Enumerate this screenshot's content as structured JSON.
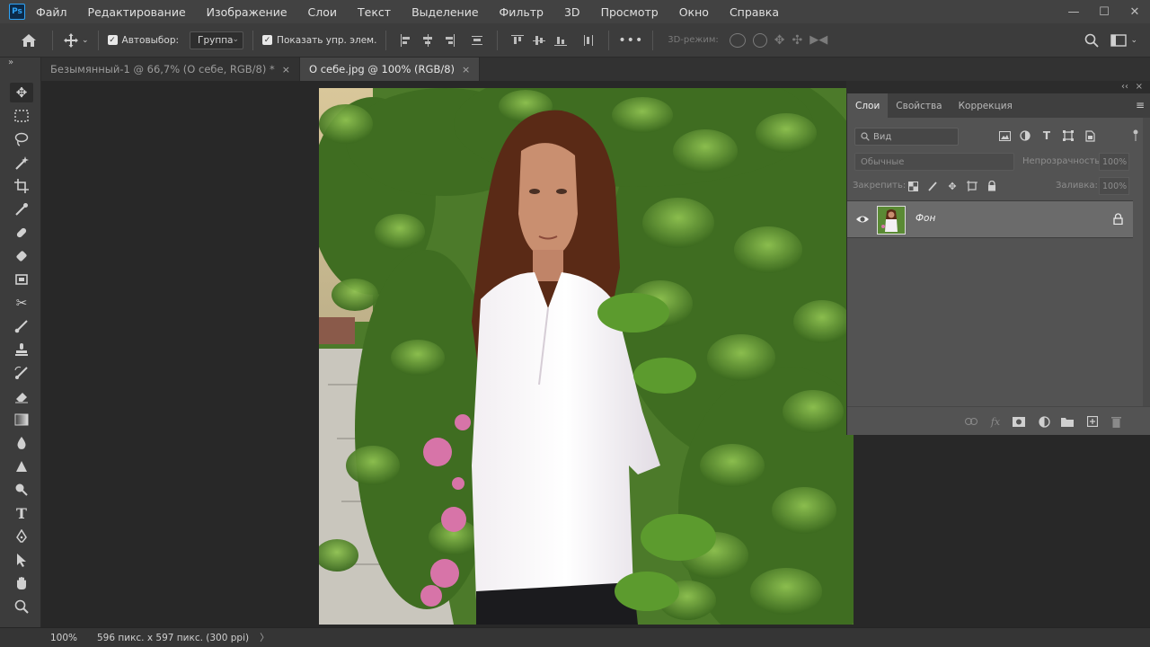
{
  "app": {
    "logo": "Ps"
  },
  "menu": [
    "Файл",
    "Редактирование",
    "Изображение",
    "Слои",
    "Текст",
    "Выделение",
    "Фильтр",
    "3D",
    "Просмотр",
    "Окно",
    "Справка"
  ],
  "window_controls": {
    "minimize": "—",
    "maximize": "☐",
    "close": "✕"
  },
  "options": {
    "autoselect_label": "Автовыбор:",
    "autoselect_checked": true,
    "group_value": "Группа",
    "show_transform_label": "Показать упр. элем.",
    "show_transform_checked": true,
    "mode3d_label": "3D-режим:"
  },
  "toolbar": {
    "collapse": "»",
    "tools": [
      "move-tool",
      "marquee-tool",
      "lasso-tool",
      "magic-wand-tool",
      "crop-tool",
      "eyedropper-tool",
      "healing-brush-tool",
      "patch-tool",
      "frame-tool",
      "content-aware-move-tool",
      "brush-tool",
      "clone-stamp-tool",
      "history-brush-tool",
      "eraser-tool",
      "gradient-tool",
      "blur-tool",
      "sharpen-tool",
      "dodge-tool",
      "type-tool",
      "pen-tool",
      "path-selection-tool",
      "hand-tool",
      "zoom-tool",
      "more-tools"
    ],
    "active_tool": "move-tool"
  },
  "tabs": [
    {
      "label": "Безымянный-1 @ 66,7% (О себе, RGB/8) *",
      "active": false,
      "close": "×"
    },
    {
      "label": "О себе.jpg @ 100% (RGB/8)",
      "active": true,
      "close": "×"
    }
  ],
  "status": {
    "zoom": "100%",
    "doc_info": "596 пикс. x 597 пикс. (300 ppi)",
    "arrow": "〉"
  },
  "layers_panel": {
    "collapse": "‹‹",
    "close": "×",
    "tabs": [
      {
        "label": "Слои",
        "active": true
      },
      {
        "label": "Свойства",
        "active": false
      },
      {
        "label": "Коррекция",
        "active": false
      }
    ],
    "menu": "≡",
    "kind_placeholder": "Вид",
    "blend_mode": "Обычные",
    "opacity_label": "Непрозрачность:",
    "opacity_value": "100%",
    "lock_label": "Закрепить:",
    "fill_label": "Заливка:",
    "fill_value": "100%",
    "layer": {
      "name": "Фон",
      "visible": true,
      "locked": true
    }
  },
  "colors": {
    "accent": "#2fa3f5",
    "panel": "#535353",
    "workspace": "#282828"
  }
}
